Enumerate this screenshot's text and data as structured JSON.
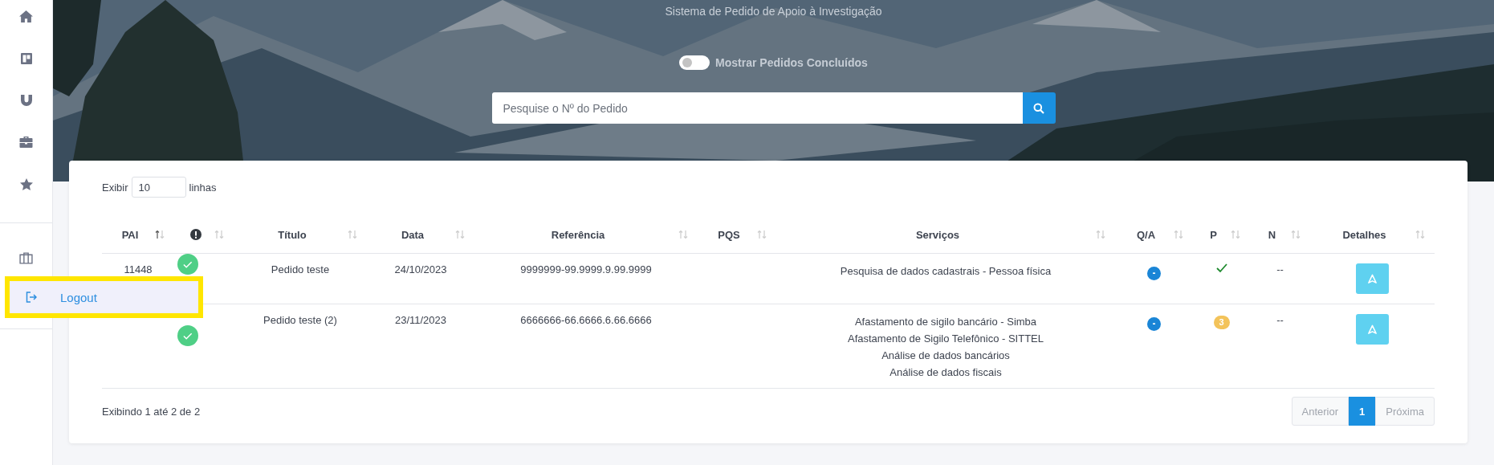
{
  "header": {
    "subtitle": "Sistema de Pedido de Apoio à Investigação",
    "toggle": {
      "label": "Mostrar Pedidos Concluídos",
      "on": false
    },
    "search": {
      "placeholder": "Pesquise o Nº do Pedido"
    }
  },
  "menu_popup": {
    "label": "Logout",
    "highlighted": true
  },
  "table": {
    "length": {
      "before": "Exibir",
      "value": "10",
      "after": "linhas"
    },
    "columns": [
      {
        "label": "PAI",
        "kind": "text",
        "sorted": true
      },
      {
        "kind": "alert-icon",
        "sorted": false
      },
      {
        "label": "Título",
        "kind": "text",
        "sorted": false
      },
      {
        "label": "Data",
        "kind": "text",
        "sorted": false
      },
      {
        "label": "Referência",
        "kind": "text",
        "sorted": false
      },
      {
        "label": "PQS",
        "kind": "text",
        "sorted": false
      },
      {
        "label": "Serviços",
        "kind": "text",
        "sorted": false
      },
      {
        "label": "Q/A",
        "kind": "text",
        "sorted": false
      },
      {
        "label": "P",
        "kind": "text",
        "sorted": false
      },
      {
        "label": "N",
        "kind": "text",
        "sorted": false
      },
      {
        "label": "Detalhes",
        "kind": "text",
        "sorted": false
      }
    ],
    "rows": [
      {
        "pai": "11448",
        "done": true,
        "titulo": "Pedido teste",
        "data": "24/10/2023",
        "referencia": "9999999-99.9999.9.99.9999",
        "servicos": [
          "Pesquisa de dados cadastrais - Pessoa física"
        ],
        "qa": "-",
        "p": {
          "kind": "check"
        },
        "n": "--"
      },
      {
        "done": true,
        "titulo": "Pedido teste (2)",
        "data": "23/11/2023",
        "referencia": "6666666-66.6666.6.66.6666",
        "servicos": [
          "Afastamento de sigilo bancário - Simba",
          "Afastamento de Sigilo Telefônico - SITTEL",
          "Análise de dados bancários",
          "Análise de dados fiscais"
        ],
        "qa": "-",
        "p": {
          "kind": "badge",
          "text": "3"
        },
        "n": "--"
      }
    ],
    "info": "Exibindo 1 até 2 de 2",
    "pagination": [
      {
        "label": "Anterior",
        "selected": false,
        "disabled": true
      },
      {
        "label": "1",
        "selected": true,
        "disabled": false
      },
      {
        "label": "Próxima",
        "selected": false,
        "disabled": true
      }
    ]
  }
}
